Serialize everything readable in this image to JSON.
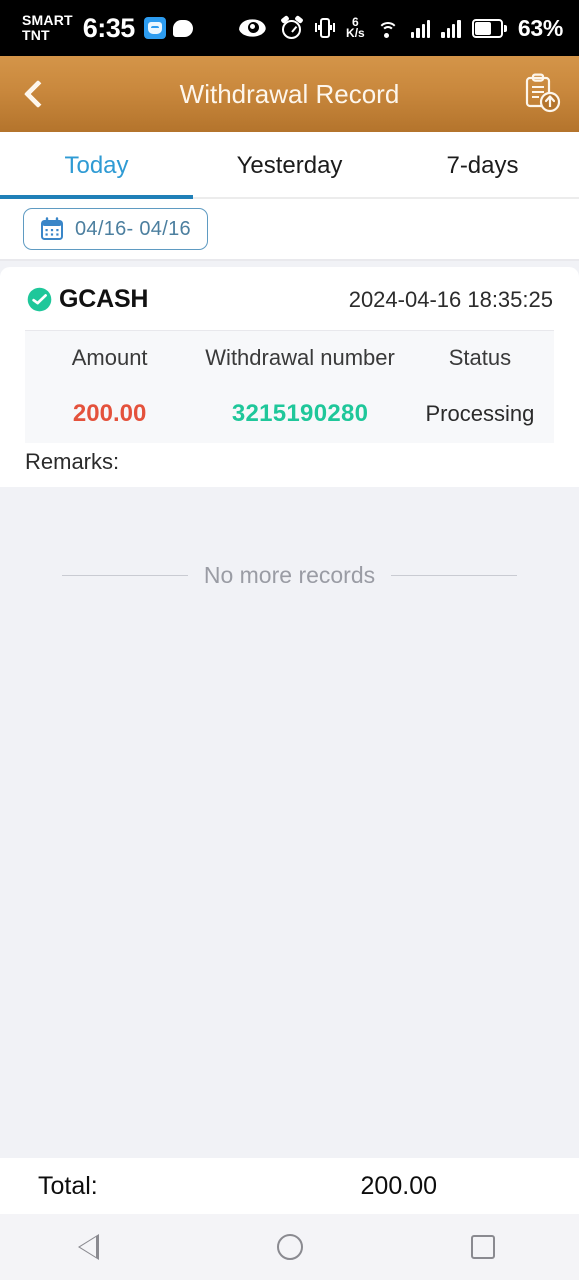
{
  "status_bar": {
    "carrier_line1": "SMART",
    "carrier_line2": "TNT",
    "time": "6:35",
    "net_speed_value": "6",
    "net_speed_unit": "K/s",
    "battery_percent": "63%",
    "icons": [
      "app-badge-icon",
      "chat-bubble-icon",
      "eye-icon",
      "alarm-icon",
      "vibrate-icon",
      "wifi-icon",
      "signal-icon",
      "signal-icon",
      "battery-icon"
    ]
  },
  "app_bar": {
    "title": "Withdrawal Record",
    "back_icon": "chevron-left-icon",
    "export_icon": "clipboard-upload-icon",
    "gradient_from": "#d49549",
    "gradient_to": "#b4742c"
  },
  "tabs": {
    "active_index": 0,
    "active_color": "#2f9bd4",
    "underline_color": "#2080b8",
    "items": [
      {
        "label": "Today"
      },
      {
        "label": "Yesterday"
      },
      {
        "label": "7-days"
      }
    ]
  },
  "filter": {
    "calendar_icon": "calendar-icon",
    "date_range": "04/16- 04/16",
    "border_color": "#5f9bc2",
    "text_color": "#4c7f9f"
  },
  "records": [
    {
      "brand": "GCASH",
      "brand_icon": "gcash-check-icon",
      "brand_icon_color": "#1fc79a",
      "timestamp": "2024-04-16 18:35:25",
      "columns": [
        "Amount",
        "Withdrawal number",
        "Status"
      ],
      "amount": "200.00",
      "amount_color": "#e4523c",
      "withdrawal_number": "3215190280",
      "withdrawal_number_color": "#1fc79a",
      "status": "Processing",
      "remarks_label": "Remarks:",
      "remarks_value": ""
    }
  ],
  "list_end": {
    "text": "No more records"
  },
  "footer": {
    "total_label": "Total:",
    "total_value": "200.00"
  },
  "nav_bar": {
    "back_icon": "nav-back-triangle-icon",
    "home_icon": "nav-home-circle-icon",
    "recents_icon": "nav-recents-square-icon"
  }
}
